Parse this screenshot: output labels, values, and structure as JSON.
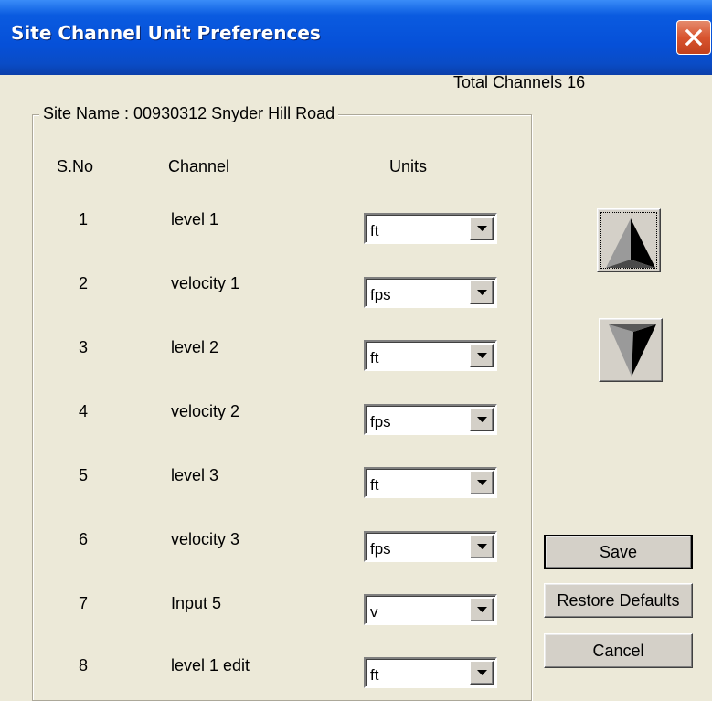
{
  "window": {
    "title": "Site Channel Unit Preferences"
  },
  "header": {
    "total_channels": "Total Channels 16"
  },
  "group": {
    "legend": "Site Name :  00930312 Snyder Hill Road"
  },
  "columns": {
    "sno": "S.No",
    "channel": "Channel",
    "units": "Units"
  },
  "rows": [
    {
      "sno": "1",
      "channel": "level 1",
      "unit": "ft"
    },
    {
      "sno": "2",
      "channel": "velocity 1",
      "unit": "fps"
    },
    {
      "sno": "3",
      "channel": "level 2",
      "unit": "ft"
    },
    {
      "sno": "4",
      "channel": "velocity 2",
      "unit": "fps"
    },
    {
      "sno": "5",
      "channel": "level 3",
      "unit": "ft"
    },
    {
      "sno": "6",
      "channel": "velocity 3",
      "unit": "fps"
    },
    {
      "sno": "7",
      "channel": "Input 5",
      "unit": "v"
    },
    {
      "sno": "8",
      "channel": "level 1 edit",
      "unit": "ft"
    }
  ],
  "buttons": {
    "save": "Save",
    "restore": "Restore Defaults",
    "cancel": "Cancel"
  },
  "icons": {
    "close": "close-icon",
    "move_up": "triangle-up-icon",
    "move_down": "triangle-down-icon",
    "dropdown": "chevron-down-icon"
  },
  "colors": {
    "titlebar": "#0A5BE0",
    "close": "#D8542F",
    "face": "#ECE9D8",
    "button_face": "#D4D0C8"
  }
}
